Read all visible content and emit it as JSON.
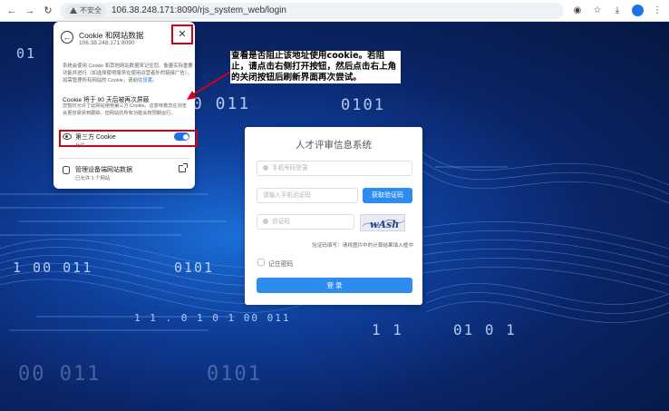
{
  "browser": {
    "security_label": "不安全",
    "url": "106.38.248.171:8090/rjs_system_web/login"
  },
  "background": {
    "binary": [
      {
        "text": "01"
      },
      {
        "text": "0 011"
      },
      {
        "text": "0101"
      },
      {
        "text": "1 00 011"
      },
      {
        "text": "0101"
      },
      {
        "text": "1 1 . 0 1 0 1   00 011"
      },
      {
        "text": "1 1"
      },
      {
        "text": "01 0 1"
      },
      {
        "text": "0101"
      },
      {
        "text": "00 011"
      }
    ]
  },
  "cookie_popup": {
    "title": "Cookie 和网站数据",
    "host": "106.38.248.171:8090",
    "description": "系统会使用 Cookie 和其他网站数据来记住您、衡量实际重要功能并进行（如选择使得服务在使用运营者外的链接广告），如需管理所有网站的 Cookie，请前往",
    "settings_link": "设置",
    "tp_heading": "Cookie 将于 90 天后被再次屏蔽",
    "tp_desc": "您暂时允许了此网站使用第三方 Cookie。这意味着您在浏览会更容易受到跟踪，但网站的所有功能会按预期运行。",
    "third_party_label": "第三方 Cookie",
    "third_party_sub": "允许",
    "manage_label": "管理设备端网站数据",
    "manage_sub": "已允许 1 个网站"
  },
  "annotation": {
    "text": "查看是否阻止该地址使用cookie。若阻止，请点击右侧打开按钮，然后点击右上角的关闭按钮后刷新界面再次尝试。"
  },
  "login": {
    "title": "人才评审信息系统",
    "phone_placeholder": "手机号码登录",
    "code_placeholder": "请输入手机验证码",
    "get_code_label": "获取验证码",
    "captcha_placeholder": "验证码",
    "captcha_text": "wAsh",
    "captcha_hint": "验证码填写：请将图片中的计算结果填入框中",
    "remember_label": "记住密码",
    "submit_label": "登 录"
  },
  "colors": {
    "accent": "#2d8cf0",
    "highlight": "#d0021b"
  }
}
